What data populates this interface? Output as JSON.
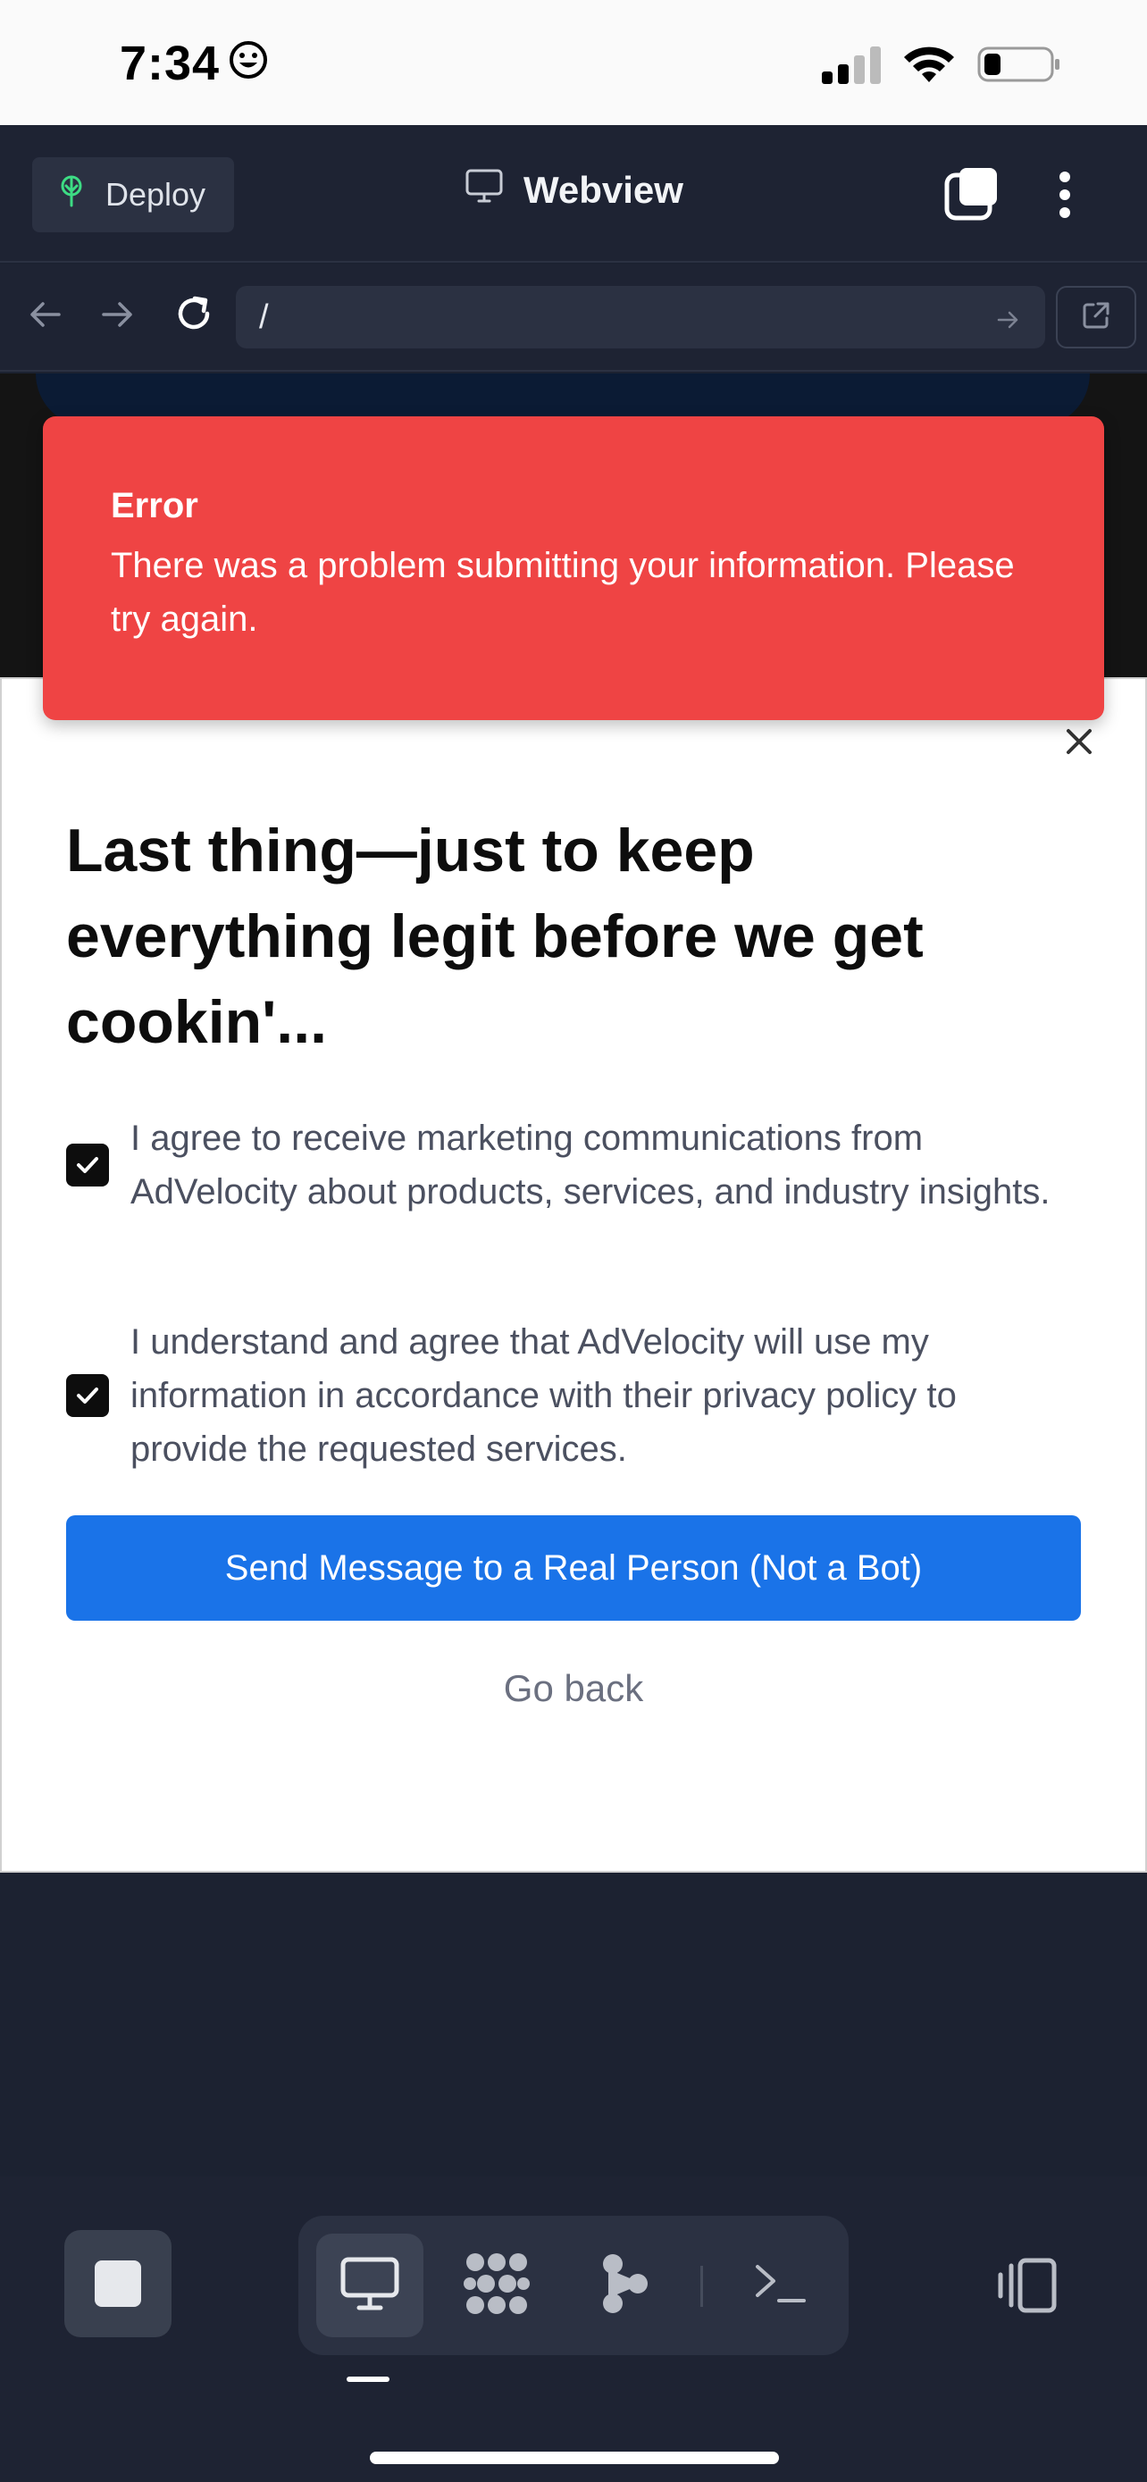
{
  "status_bar": {
    "time": "7:34",
    "time_emoji_icon": "smiley-face-icon"
  },
  "app_header": {
    "deploy_label": "Deploy",
    "title": "Webview"
  },
  "url_bar": {
    "url_value": "/"
  },
  "error_toast": {
    "title": "Error",
    "message": "There was a problem submitting your information. Please try again."
  },
  "modal": {
    "heading": "Last thing—just to keep everything legit before we get cookin'...",
    "consents": [
      {
        "checked": true,
        "text": "I agree to receive marketing communications from AdVelocity about products, services, and industry insights."
      },
      {
        "checked": true,
        "text": "I understand and agree that AdVelocity will use my information in accordance with their privacy policy to provide the requested services."
      }
    ],
    "send_label": "Send Message to a Real Person (Not a Bot)",
    "go_back_label": "Go back"
  },
  "colors": {
    "error": "#ef4444",
    "primary_button": "#1a73e8",
    "app_background": "#1e2333"
  }
}
